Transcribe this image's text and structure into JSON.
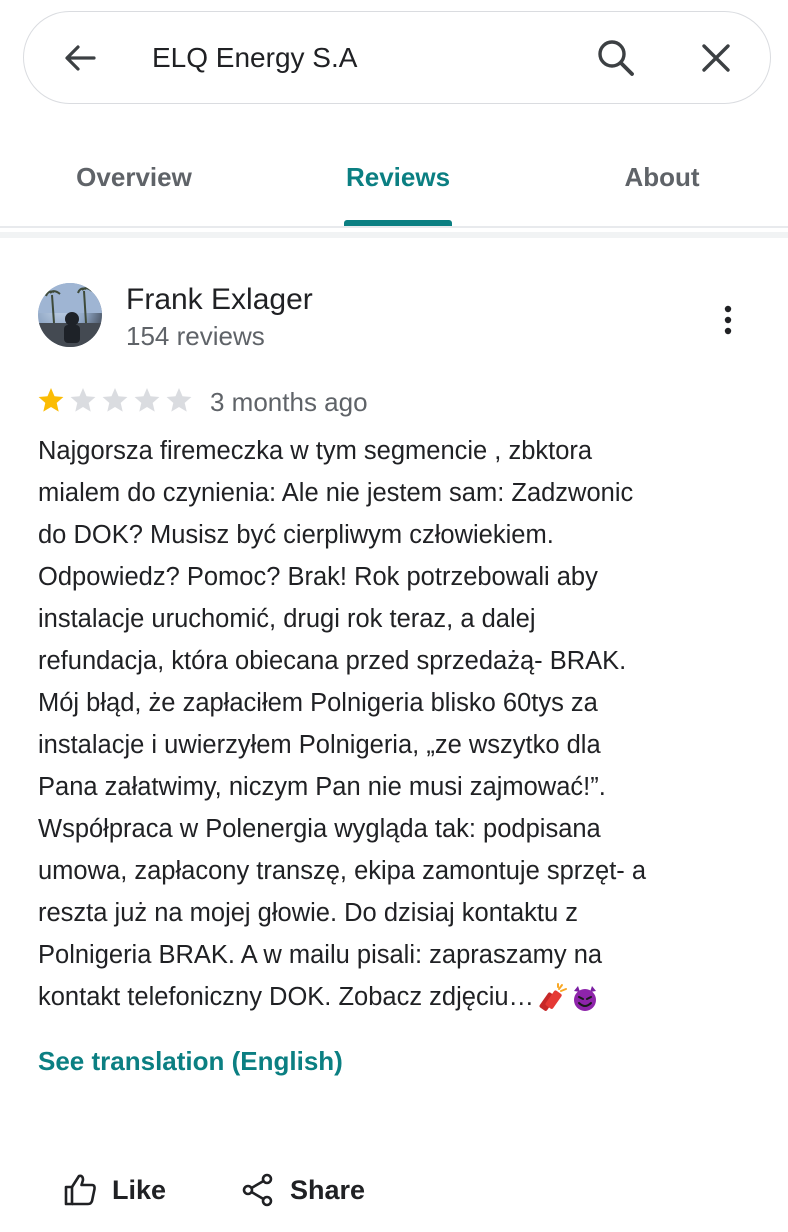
{
  "search": {
    "query": "ELQ Energy S.A",
    "icons": {
      "back": "arrow-back-icon",
      "search": "search-icon",
      "close": "close-icon"
    }
  },
  "tabs": [
    {
      "label": "Overview",
      "active": false
    },
    {
      "label": "Reviews",
      "active": true
    },
    {
      "label": "About",
      "active": false
    }
  ],
  "review": {
    "author": "Frank Exlager",
    "author_reviews": "154 reviews",
    "rating": 1,
    "max_rating": 5,
    "date": "3 months ago",
    "text": "Najgorsza firemeczka w tym segmencie , zbktora\nmialem do czynienia: Ale nie jestem sam: Zadzwonic\ndo DOK? Musisz być cierpliwym człowiekiem.\nOdpowiedz? Pomoc? Brak! Rok potrzebowali aby\ninstalacje uruchomić, drugi rok teraz, a dalej\nrefundacja, która obiecana przed sprzedażą- BRAK.\nMój błąd, że zapłaciłem Polnigeria blisko 60tys za\ninstalacje i uwierzyłem Polnigeria, „ze wszytko dla\nPana załatwimy, niczym Pan nie musi zajmować!”.\nWspółpraca w Polenergia wygląda tak: podpisana\numowa, zapłacony transzę, ekipa zamontuje sprzęt- a\nreszta już na mojej głowie. Do dzisiaj kontaktu z\nPolnigeria BRAK. A w mailu pisali: zapraszamy na\nkontakt telefoniczny DOK. Zobacz zdjęciu…",
    "emojis": [
      "firecracker-emoji",
      "smiling-devil-emoji"
    ],
    "translate_link": "See translation (English)"
  },
  "actions": {
    "like": "Like",
    "share": "Share"
  },
  "colors": {
    "accent": "#0b7f82",
    "star_filled": "#fbbc04",
    "star_empty": "#dadce0",
    "secondary_text": "#5f6368"
  }
}
